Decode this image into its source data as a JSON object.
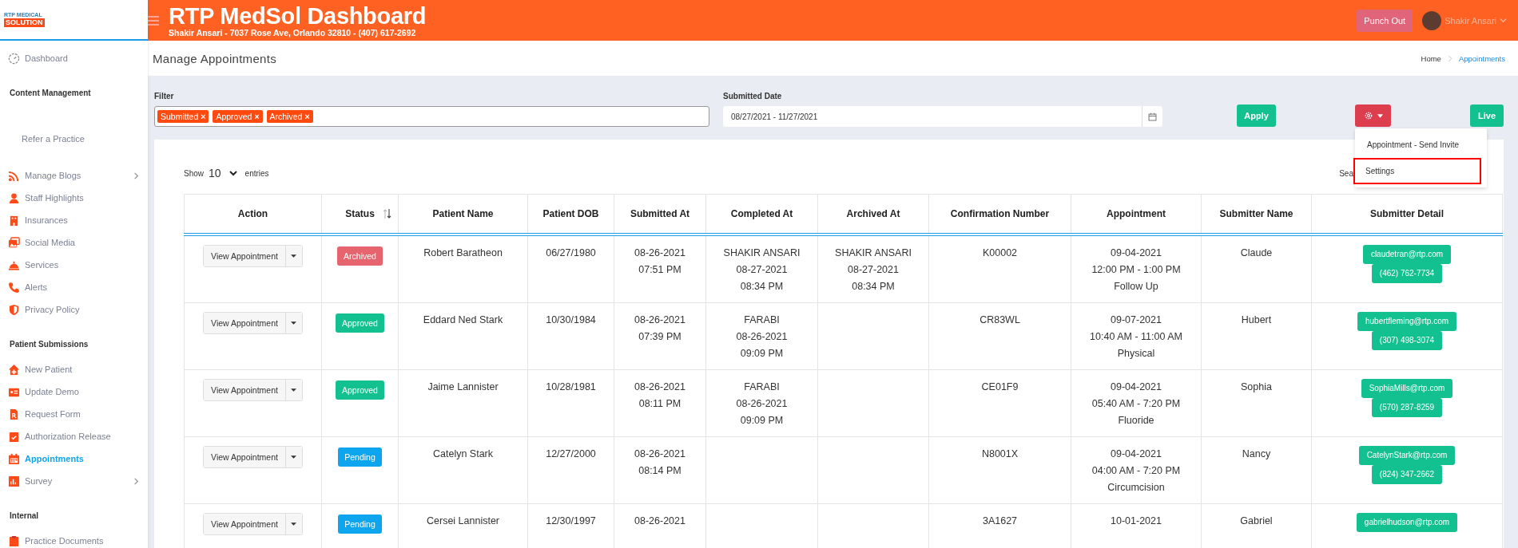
{
  "logo": {
    "line_1": "RTP MEDICAL",
    "line_2": "SOLUTION"
  },
  "header": {
    "title": "RTP MedSol Dashboard",
    "subtitle": "Shakir Ansari - 7037 Rose Ave, Orlando 32810 - (407) 617-2692",
    "punch_out": "Punch Out",
    "user_name": "Shakir Ansari"
  },
  "sidebar": {
    "sections": [
      {
        "items": [
          {
            "label": "Dashboard",
            "selected": false
          }
        ]
      },
      {
        "heading": "Content Management",
        "items": [
          {
            "label": "Refer a Practice",
            "selected": false
          },
          {
            "label": "Manage Blogs",
            "selected": false,
            "expandable": true
          },
          {
            "label": "Staff Highlights",
            "selected": false
          },
          {
            "label": "Insurances",
            "selected": false
          },
          {
            "label": "Social Media",
            "selected": false
          },
          {
            "label": "Services",
            "selected": false
          },
          {
            "label": "Alerts",
            "selected": false
          },
          {
            "label": "Privacy Policy",
            "selected": false
          }
        ]
      },
      {
        "heading": "Patient Submissions",
        "items": [
          {
            "label": "New Patient",
            "selected": false
          },
          {
            "label": "Update Demo",
            "selected": false
          },
          {
            "label": "Request Form",
            "selected": false
          },
          {
            "label": "Authorization Release",
            "selected": false
          },
          {
            "label": "Appointments",
            "selected": true
          },
          {
            "label": "Survey",
            "selected": false,
            "expandable": true
          }
        ]
      },
      {
        "heading": "Internal",
        "items": [
          {
            "label": "Practice Documents",
            "selected": false
          }
        ]
      }
    ]
  },
  "page": {
    "title": "Manage Appointments",
    "breadcrumb": [
      {
        "label": "Home",
        "selected": false
      },
      {
        "label": "Appointments",
        "selected": true
      }
    ]
  },
  "filter": {
    "label": "Filter",
    "tags": [
      {
        "label": "Submitted",
        "remove": "×"
      },
      {
        "label": "Approved",
        "remove": "×"
      },
      {
        "label": "Archived",
        "remove": "×"
      }
    ],
    "date_label": "Submitted Date",
    "date_value": "08/27/2021 - 11/27/2021",
    "apply": "Apply",
    "live": "Live"
  },
  "settings_menu": {
    "items": [
      {
        "label": "Appointment - Send Invite",
        "highlighted": false
      },
      {
        "label": "Settings",
        "highlighted": true
      }
    ]
  },
  "entries": {
    "show": "Show",
    "value": "10",
    "suffix": "entries",
    "search_label": "Sea"
  },
  "table": {
    "columns": [
      {
        "label": "Action"
      },
      {
        "label": "Status",
        "sortable": true
      },
      {
        "label": "Patient Name"
      },
      {
        "label": "Patient DOB"
      },
      {
        "label": "Submitted At"
      },
      {
        "label": "Completed At"
      },
      {
        "label": "Archived At"
      },
      {
        "label": "Confirmation Number"
      },
      {
        "label": "Appointment"
      },
      {
        "label": "Submitter Name"
      },
      {
        "label": "Submitter Detail"
      }
    ],
    "rows": [
      {
        "action": "View Appointment",
        "status": "Archived",
        "kind": "archived",
        "patient_name": "Robert Baratheon",
        "dob": "06/27/1980",
        "submitted_at": [
          "08-26-2021",
          "07:51 PM"
        ],
        "completed_at": [
          "SHAKIR ANSARI",
          "08-27-2021",
          "08:34 PM"
        ],
        "archived_at": [
          "SHAKIR ANSARI",
          "08-27-2021",
          "08:34 PM"
        ],
        "confirmation": "K00002",
        "appointment": [
          "09-04-2021",
          "12:00 PM - 1:00 PM",
          "Follow Up"
        ],
        "submitter_name": "Claude",
        "email": "claudetran@rtp.com",
        "phone": "(462) 762-7734"
      },
      {
        "action": "View Appointment",
        "status": "Approved",
        "kind": "approved",
        "patient_name": "Eddard Ned Stark",
        "dob": "10/30/1984",
        "submitted_at": [
          "08-26-2021",
          "07:39 PM"
        ],
        "completed_at": [
          "FARABI",
          "08-26-2021",
          "09:09 PM"
        ],
        "archived_at": [],
        "confirmation": "CR83WL",
        "appointment": [
          "09-07-2021",
          "10:40 AM - 11:00 AM",
          "Physical"
        ],
        "submitter_name": "Hubert",
        "email": "hubertfleming@rtp.com",
        "phone": "(307) 498-3074"
      },
      {
        "action": "View Appointment",
        "status": "Approved",
        "kind": "approved",
        "patient_name": "Jaime Lannister",
        "dob": "10/28/1981",
        "submitted_at": [
          "08-26-2021",
          "08:11 PM"
        ],
        "completed_at": [
          "FARABI",
          "08-26-2021",
          "09:09 PM"
        ],
        "archived_at": [],
        "confirmation": "CE01F9",
        "appointment": [
          "09-04-2021",
          "05:40 AM - 7:20 PM",
          "Fluoride"
        ],
        "submitter_name": "Sophia",
        "email": "SophiaMills@rtp.com",
        "phone": "(570) 287-8259"
      },
      {
        "action": "View Appointment",
        "status": "Pending",
        "kind": "pending",
        "patient_name": "Catelyn Stark",
        "dob": "12/27/2000",
        "submitted_at": [
          "08-26-2021",
          "08:14 PM"
        ],
        "completed_at": [],
        "archived_at": [],
        "confirmation": "N8001X",
        "appointment": [
          "09-04-2021",
          "04:00 AM - 7:20 PM",
          "Circumcision"
        ],
        "submitter_name": "Nancy",
        "email": "CatelynStark@rtp.com",
        "phone": "(824) 347-2662"
      },
      {
        "action": "View Appointment",
        "status": "Pending",
        "kind": "pending",
        "patient_name": "Cersei Lannister",
        "dob": "12/30/1997",
        "submitted_at": [
          "08-26-2021"
        ],
        "completed_at": [],
        "archived_at": [],
        "confirmation": "3A1627",
        "appointment": [
          "10-01-2021"
        ],
        "submitter_name": "Gabriel",
        "email": "gabrielhudson@rtp.com"
      }
    ]
  }
}
